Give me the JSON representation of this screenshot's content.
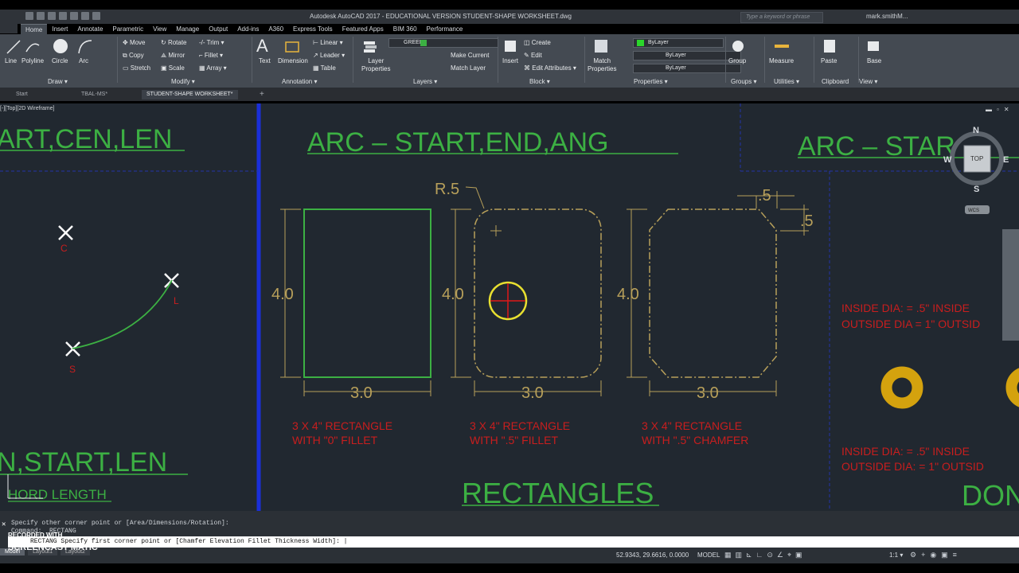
{
  "app": {
    "title": "Autodesk AutoCAD 2017 - EDUCATIONAL VERSION   STUDENT-SHAPE WORKSHEET.dwg",
    "search_placeholder": "Type a keyword or phrase",
    "user": "mark.smithM..."
  },
  "ribbon_tabs": [
    "Home",
    "Insert",
    "Annotate",
    "Parametric",
    "View",
    "Manage",
    "Output",
    "Add-ins",
    "A360",
    "Express Tools",
    "Featured Apps",
    "BIM 360",
    "Performance"
  ],
  "draw": {
    "line": "Line",
    "polyline": "Polyline",
    "circle": "Circle",
    "arc": "Arc",
    "title": "Draw ▾"
  },
  "modify": {
    "move": "Move",
    "rotate": "Rotate",
    "trim": "Trim ▾",
    "copy": "Copy",
    "mirror": "Mirror",
    "fillet": "Fillet ▾",
    "stretch": "Stretch",
    "scale": "Scale",
    "array": "Array ▾",
    "title": "Modify ▾"
  },
  "annotation": {
    "text": "Text",
    "dimension": "Dimension",
    "linear": "Linear ▾",
    "leader": "Leader ▾",
    "table": "Table",
    "title": "Annotation ▾"
  },
  "layers": {
    "props_line1": "Layer",
    "props_line2": "Properties",
    "current": "GREEN",
    "make_current": "Make Current",
    "match_layer": "Match Layer",
    "title": "Layers ▾"
  },
  "block": {
    "insert": "Insert",
    "create": "Create",
    "edit": "Edit",
    "edit_attr": "Edit Attributes ▾",
    "title": "Block ▾"
  },
  "properties": {
    "match_line1": "Match",
    "match_line2": "Properties",
    "color": "ByLayer",
    "linetype": "ByLayer",
    "lineweight": "ByLayer",
    "title": "Properties ▾"
  },
  "groups": {
    "label": "Group",
    "title": "Groups ▾"
  },
  "utilities": {
    "label": "Measure",
    "title": "Utilities ▾"
  },
  "clipboard": {
    "label": "Paste",
    "title": "Clipboard"
  },
  "view": {
    "label": "Base",
    "title": "View ▾"
  },
  "doc_tabs": [
    "Start",
    "TBAL-MS*",
    "STUDENT-SHAPE WORKSHEET*"
  ],
  "viewport_label": "[-][Top][2D Wireframe]",
  "viewcube": {
    "top": "TOP",
    "n": "N",
    "s": "S",
    "e": "E",
    "w": "W",
    "wcs": "WCS"
  },
  "drawing": {
    "arc_title_left": "ART,CEN,LEN",
    "arc_title_mid": "ARC  –  START,END,ANG",
    "arc_title_right": "ARC  –  STAR",
    "pt_c": "C",
    "pt_l": "L",
    "pt_s": "S",
    "dim_radius": "R.5",
    "dim_h1": "4.0",
    "dim_h2": "4.0",
    "dim_h3": "4.0",
    "dim_w1": "3.0",
    "dim_w2": "3.0",
    "dim_w3": "3.0",
    "dim_ch1": ".5",
    "dim_ch2": ".5",
    "rect1_line1": "3  X  4\"  RECTANGLE",
    "rect1_line2": "WITH  \"0\"  FILLET",
    "rect2_line1": "3  X  4\"  RECTANGLE",
    "rect2_line2": "WITH  \".5\"  FILLET",
    "rect3_line1": "3  X  4\"  RECTANGLE",
    "rect3_line2": "WITH  \".5\"  CHAMFER",
    "donut1_line1": "INSIDE  DIA:  =  .5\"   INSIDE",
    "donut1_line2": "OUTSIDE  DIA  =  1\"   OUTSID",
    "donut2_line1": "INSIDE  DIA:  =  .5\"   INSIDE",
    "donut2_line2": "OUTSIDE  DIA:  =  1\"   OUTSID",
    "lower_left_title": "N,START,LEN",
    "chord_label": "HORD  LENGTH",
    "rectangles_title": "RECTANGLES",
    "donut_title": "DON"
  },
  "command": {
    "line1": "Specify other corner point or [Area/Dimensions/Rotation]:",
    "line2": "Command: _RECTANG",
    "prompt": "RECTANG Specify first corner point or [Chamfer Elevation Fillet Thickness Width]:"
  },
  "watermark": {
    "line1": "RECORDED WITH",
    "line2": "SCREENCAST  MATIC"
  },
  "status": {
    "coords": "52.9343, 29.6616, 0.0000",
    "model": "MODEL",
    "scale": "1:1 ▾"
  },
  "model_tabs": [
    "Model",
    "Layout1",
    "Layout2"
  ],
  "colors": {
    "drawing_green": "#3cb043",
    "annotation_red": "#c81e1e",
    "dimension_tan": "#b8a05a",
    "viewport_blue": "#1a2fd9",
    "canvas": "#212830",
    "donut": "#d4a20e"
  }
}
